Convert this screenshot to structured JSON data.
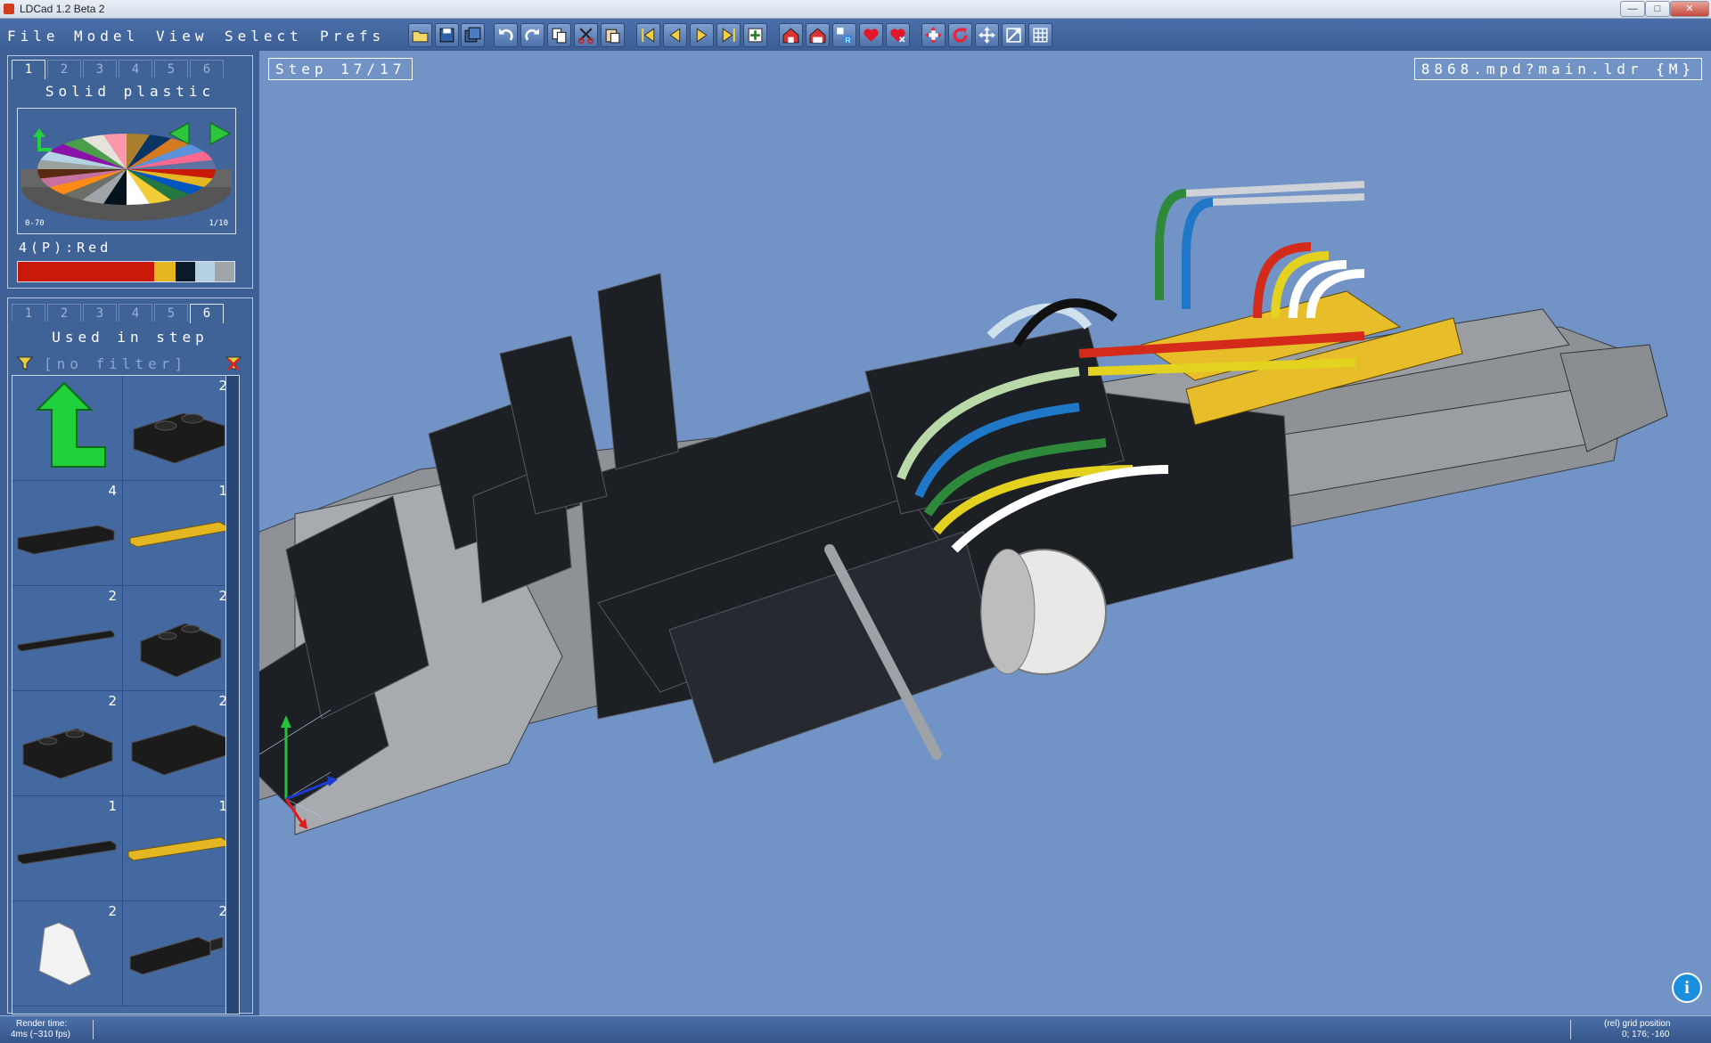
{
  "window": {
    "title": "LDCad 1.2 Beta 2",
    "controls": [
      "—",
      "□",
      "✕"
    ]
  },
  "menu": [
    "File",
    "Model",
    "View",
    "Select",
    "Prefs"
  ],
  "toolbar_icons": [
    "open-icon",
    "save-icon",
    "save-all-icon",
    "undo-icon",
    "redo-icon",
    "copy-icon",
    "cut-icon",
    "paste-icon",
    "first-step-icon",
    "prev-step-icon",
    "next-step-icon",
    "last-step-icon",
    "add-step-icon",
    "home-group-icon",
    "home-add-icon",
    "rotate-group-icon",
    "favorite-icon",
    "favorite-remove-icon",
    "move-icon",
    "rotate-icon",
    "pan-icon",
    "scale-icon",
    "grid-icon"
  ],
  "color_panel": {
    "tabs": [
      "1",
      "2",
      "3",
      "4",
      "5",
      "6"
    ],
    "active_tab": "1",
    "title": "Solid plastic",
    "range_left": "0-70",
    "range_right": "1/10",
    "selected_color": "4(P):Red",
    "swatches": [
      "#c91a09",
      "#e4b622",
      "#0a1a2a",
      "#b4d2e3",
      "#a0a5a9"
    ]
  },
  "parts_panel": {
    "tabs": [
      "1",
      "2",
      "3",
      "4",
      "5",
      "6"
    ],
    "active_tab": "6",
    "title": "Used in step",
    "filter": "[no filter]",
    "items": [
      {
        "name": "up",
        "count": ""
      },
      {
        "name": "black-plate-1x2",
        "count": "2"
      },
      {
        "name": "black-plate-1x4",
        "count": "4"
      },
      {
        "name": "yellow-technic-plate-1x8",
        "count": "1"
      },
      {
        "name": "black-plate-1x10",
        "count": "2"
      },
      {
        "name": "black-plate-2x2",
        "count": "2"
      },
      {
        "name": "black-plate-2x3",
        "count": "2"
      },
      {
        "name": "black-plate-2x4",
        "count": "2"
      },
      {
        "name": "black-plate-1x8",
        "count": "1"
      },
      {
        "name": "yellow-plate-1x10",
        "count": "1"
      },
      {
        "name": "white-slope",
        "count": "2"
      },
      {
        "name": "black-technic-pin",
        "count": "2"
      }
    ]
  },
  "viewport": {
    "step_label": "Step 17/17",
    "model_label": "8868.mpd?main.ldr {M}"
  },
  "status": {
    "render_label": "Render time:",
    "render_value": "4ms (~310 fps)",
    "grid_label": "(rel) grid position",
    "grid_value": "0; 176; -160"
  }
}
